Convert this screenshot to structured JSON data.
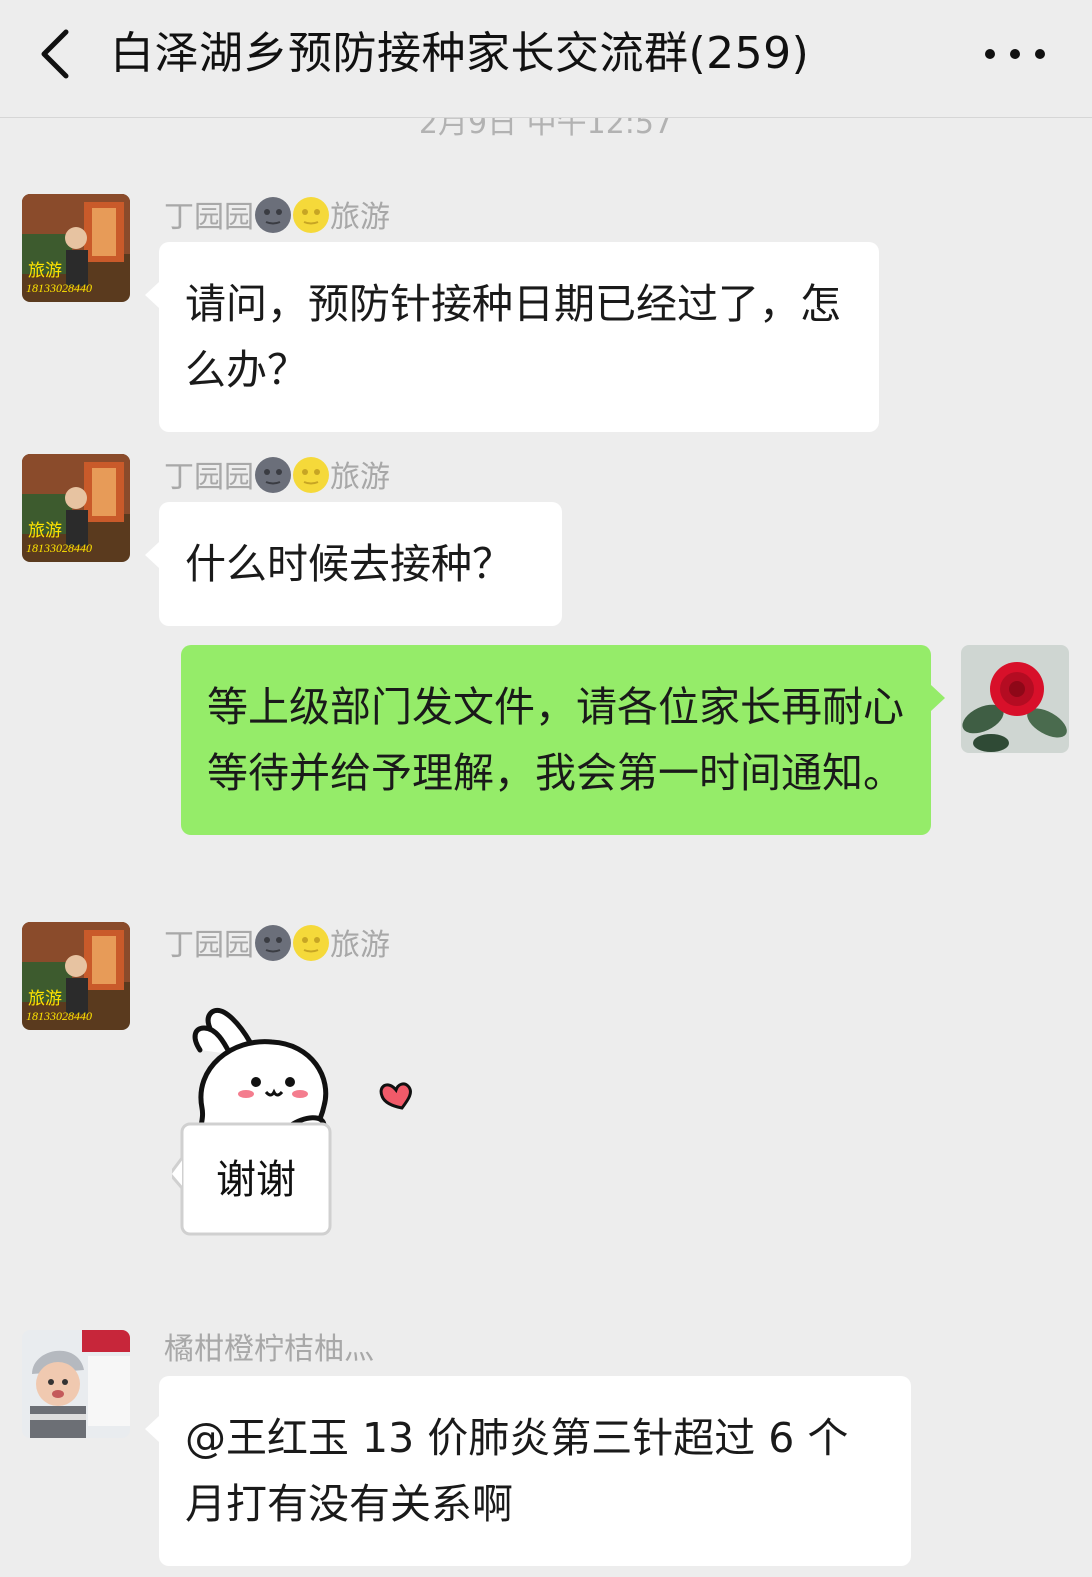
{
  "header": {
    "title": "白泽湖乡预防接种家长交流群(259)",
    "back_icon": "chevron-left-icon",
    "more_icon": "more-dots-icon"
  },
  "timestamp": "2月9日 中午12:57",
  "messages": [
    {
      "sender": "丁园园",
      "sender_suffix": "旅游",
      "avatar_text": "旅游",
      "avatar_number": "18133028440",
      "text": "请问，预防针接种日期已经过了，怎么办？"
    },
    {
      "sender": "丁园园",
      "sender_suffix": "旅游",
      "avatar_text": "旅游",
      "avatar_number": "18133028440",
      "text": "什么时候去接种？"
    },
    {
      "self": true,
      "text": "等上级部门发文件，请各位家长再耐心等待并给予理解，我会第一时间通知。"
    },
    {
      "sender": "丁园园",
      "sender_suffix": "旅游",
      "avatar_text": "旅游",
      "avatar_number": "18133028440",
      "sticker_text": "谢谢"
    },
    {
      "sender": "橘柑橙柠桔柚灬",
      "text": "@王红玉  13 价肺炎第三针超过 6 个月打有没有关系啊"
    }
  ],
  "colors": {
    "background": "#ededed",
    "bubble_in": "#ffffff",
    "bubble_out": "#95ec69",
    "sender_name": "#a8a8a8"
  }
}
